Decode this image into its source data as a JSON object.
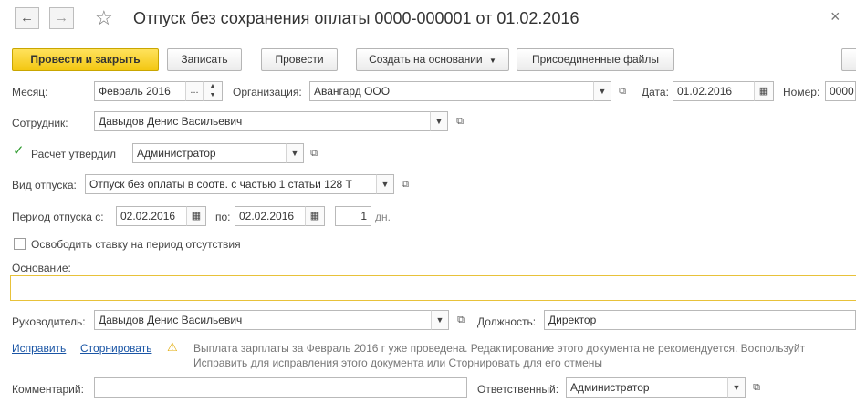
{
  "window": {
    "title": "Отпуск без сохранения оплаты 0000-000001 от 01.02.2016",
    "close_icon": "×",
    "back_icon": "←",
    "forward_icon": "→",
    "star_icon": "☆"
  },
  "toolbar": {
    "post_close": "Провести и закрыть",
    "save": "Записать",
    "post": "Провести",
    "create_based": "Создать на основании",
    "attached_files": "Присоединенные файлы"
  },
  "form": {
    "month_label": "Месяц:",
    "month_value": "Февраль 2016",
    "month_ellipsis": "...",
    "org_label": "Организация:",
    "org_value": "Авангард ООО",
    "date_label": "Дата:",
    "date_value": "01.02.2016",
    "number_label": "Номер:",
    "number_value": "0000",
    "employee_label": "Сотрудник:",
    "employee_value": "Давыдов Денис Васильевич",
    "approved_label": "Расчет утвердил",
    "approved_checked": true,
    "approved_value": "Администратор",
    "leave_type_label": "Вид отпуска:",
    "leave_type_value": "Отпуск без оплаты в соотв. с частью 1 статьи 128 Т",
    "period_from_label": "Период отпуска с:",
    "period_from_value": "02.02.2016",
    "period_to_label": "по:",
    "period_to_value": "02.02.2016",
    "days_value": "1",
    "days_unit": "дн.",
    "release_rate_label": "Освободить ставку на период отсутствия",
    "basis_label": "Основание:",
    "basis_value": "",
    "manager_label": "Руководитель:",
    "manager_value": "Давыдов Денис Васильевич",
    "position_label": "Должность:",
    "position_value": "Директор",
    "fix_link": "Исправить",
    "reverse_link": "Сторнировать",
    "warning_line1": "Выплата зарплаты за Февраль 2016 г уже проведена. Редактирование этого документа не рекомендуется. Воспользуйт",
    "warning_line2": "Исправить для исправления этого документа или Сторнировать для его отмены",
    "comment_label": "Комментарий:",
    "comment_value": "",
    "responsible_label": "Ответственный:",
    "responsible_value": "Администратор"
  },
  "colors": {
    "primary_button": "#f3c712",
    "link": "#1a55a5",
    "focus_border": "#e8c23a",
    "checkmark": "#2e9b2e"
  }
}
